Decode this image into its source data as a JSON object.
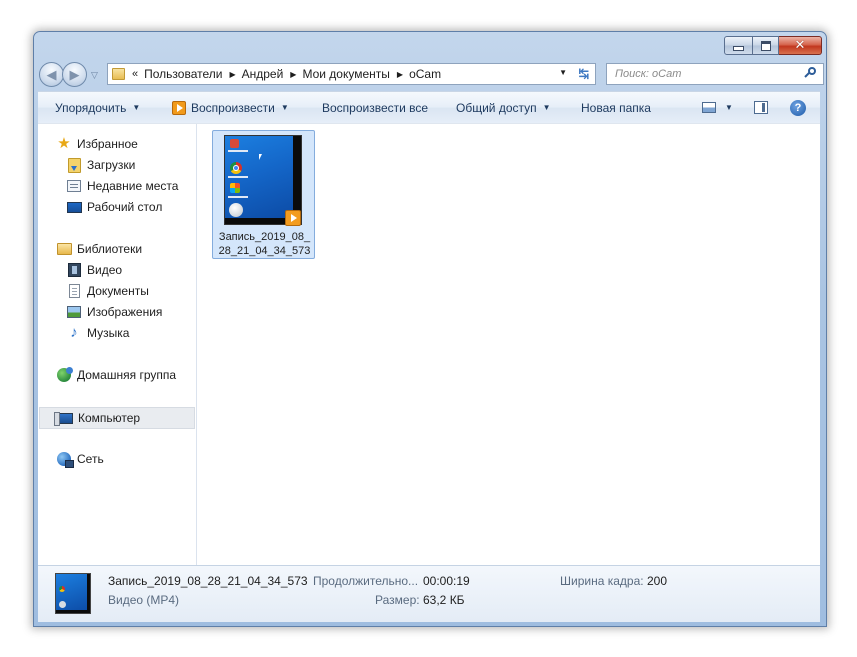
{
  "address_bar": {
    "prefix": "«",
    "crumbs": [
      "Пользователи",
      "Андрей",
      "Мои документы",
      "oCam"
    ]
  },
  "search": {
    "placeholder": "Поиск: oCam"
  },
  "toolbar": {
    "organize": "Упорядочить",
    "play": "Воспроизвести",
    "play_all": "Воспроизвести все",
    "share": "Общий доступ",
    "new_folder": "Новая папка"
  },
  "nav": {
    "favorites": "Избранное",
    "downloads": "Загрузки",
    "recent_places": "Недавние места",
    "desktop": "Рабочий стол",
    "libraries": "Библиотеки",
    "videos": "Видео",
    "documents": "Документы",
    "pictures": "Изображения",
    "music": "Музыка",
    "homegroup": "Домашняя группа",
    "computer": "Компьютер",
    "network": "Сеть"
  },
  "file": {
    "name_line1": "Запись_2019_08_",
    "name_line2": "28_21_04_34_573"
  },
  "details": {
    "name": "Запись_2019_08_28_21_04_34_573",
    "type": "Видео (MP4)",
    "duration_label": "Продолжительно...",
    "duration_value": "00:00:19",
    "size_label": "Размер:",
    "size_value": "63,2 КБ",
    "width_label": "Ширина кадра:",
    "width_value": "200"
  },
  "icons": {
    "back": "back-arrow-icon",
    "forward": "forward-arrow-icon",
    "refresh": "refresh-icon",
    "search": "search-icon",
    "help": "help-icon"
  },
  "colors": {
    "frame": "#aac4e2",
    "selection": "#d4e6fb",
    "close": "#c2371f"
  }
}
